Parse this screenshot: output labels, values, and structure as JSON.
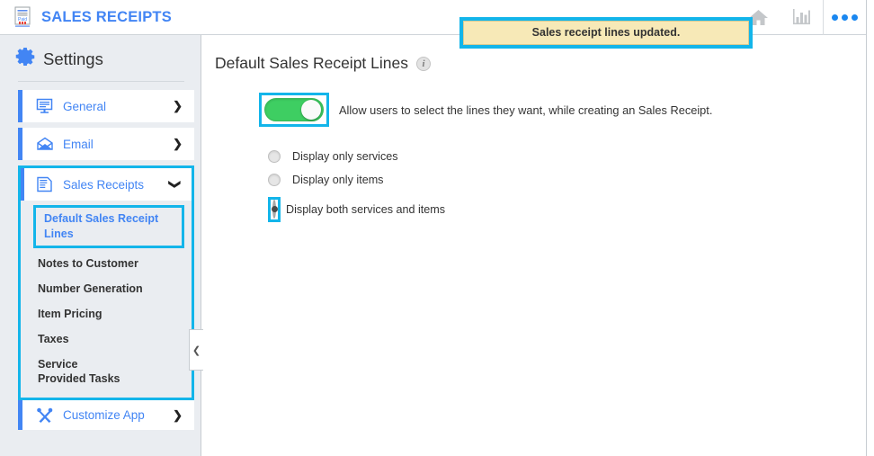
{
  "header": {
    "logo_icon": "receipt-paid-icon",
    "title": "SALES RECEIPTS",
    "icons": [
      {
        "name": "home-icon",
        "glyph": "home"
      },
      {
        "name": "reports-bar-chart-icon",
        "glyph": "bar-chart"
      },
      {
        "name": "more-options-icon",
        "glyph": "three-dots"
      }
    ]
  },
  "notification": {
    "message": "Sales receipt lines updated.",
    "background_color": "#f7e9b7",
    "highlight_color": "#13b5ea"
  },
  "sidebar": {
    "gear_icon": "gear-icon",
    "title": "Settings",
    "items": [
      {
        "label": "General",
        "icon": "monitor-screen-icon",
        "chevron": "❯",
        "expanded": false
      },
      {
        "label": "Email",
        "icon": "envelope-icon",
        "chevron": "❯",
        "expanded": false
      },
      {
        "label": "Sales Receipts",
        "icon": "document-list-icon",
        "chevron": "❯",
        "expanded": true
      }
    ],
    "sub_items": [
      {
        "label": "Default Sales Receipt Lines",
        "active": true
      },
      {
        "label": "Notes to Customer",
        "active": false
      },
      {
        "label": "Number Generation",
        "active": false
      },
      {
        "label": "Item Pricing",
        "active": false
      },
      {
        "label": "Taxes",
        "active": false
      },
      {
        "label": "Service Provided Tasks",
        "active": false
      }
    ],
    "customize": {
      "label": "Customize App",
      "icon": "tools-cross-icon",
      "chevron": "❯"
    },
    "accent_color": "#4285f4",
    "link_color": "#4285f4",
    "background_color": "#eaedf1"
  },
  "content": {
    "page_title": "Default Sales Receipt Lines",
    "info_icon": "info-icon",
    "info_glyph": "i",
    "collapse_handle": "❮",
    "toggle": {
      "name": "allow-users-select-lines-toggle",
      "state": "on",
      "label": "Allow users to select the lines they want, while creating an Sales Receipt.",
      "on_color": "#3ece62"
    },
    "radio_options": [
      {
        "label": "Display only services",
        "selected": false
      },
      {
        "label": "Display only items",
        "selected": false
      },
      {
        "label": "Display both services and items",
        "selected": true
      }
    ]
  }
}
